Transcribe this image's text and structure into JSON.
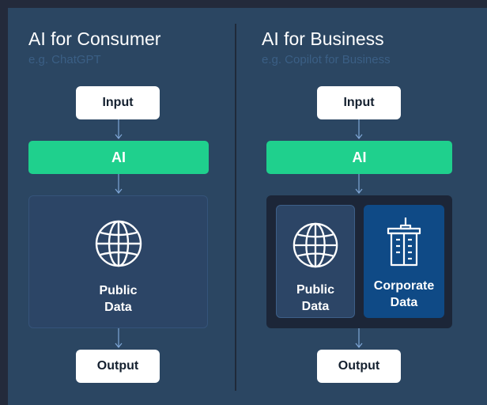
{
  "consumer": {
    "title": "AI for Consumer",
    "subtitle": "e.g. ChatGPT",
    "input_label": "Input",
    "ai_label": "AI",
    "data_label_line1": "Public",
    "data_label_line2": "Data",
    "output_label": "Output"
  },
  "business": {
    "title": "AI for Business",
    "subtitle": "e.g. Copilot for Business",
    "input_label": "Input",
    "ai_label": "AI",
    "public_label_line1": "Public",
    "public_label_line2": "Data",
    "corporate_label_line1": "Corporate",
    "corporate_label_line2": "Data",
    "output_label": "Output"
  },
  "colors": {
    "background": "#232a3b",
    "panel": "#2b4662",
    "ai_green": "#1fd08d",
    "public_card": "#2c4566",
    "corporate_card": "#0f4a86",
    "container_dark": "#1c2638"
  },
  "icons": {
    "public": "globe-icon",
    "corporate": "office-building-icon"
  }
}
